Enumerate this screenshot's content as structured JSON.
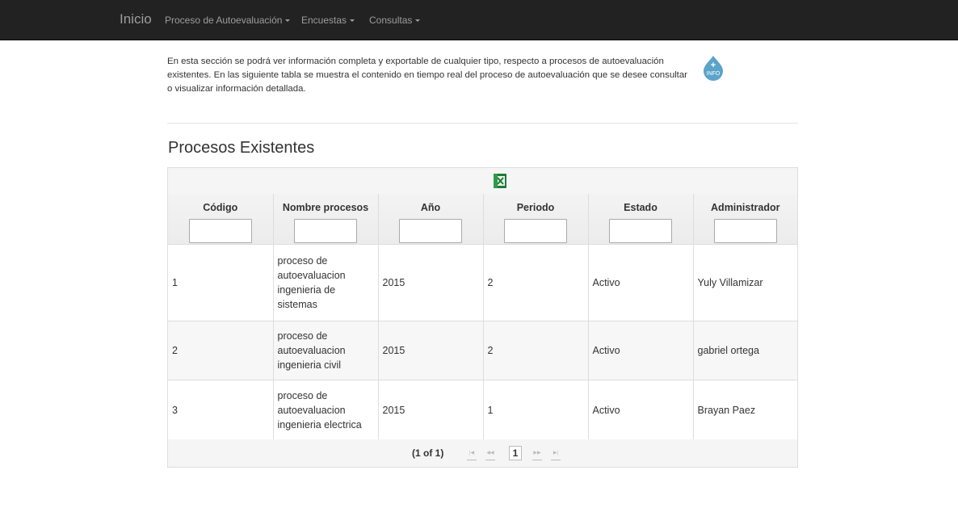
{
  "navbar": {
    "brand": "Inicio",
    "items": [
      {
        "label": "Proceso de Autoevaluación"
      },
      {
        "label": "Encuestas"
      },
      {
        "label": "Consultas"
      }
    ]
  },
  "intro": {
    "text": "En esta sección se podrá ver información completa y exportable de cualquier tipo, respecto a procesos de autoevaluación existentes. En las siguiente tabla se muestra el contenido en tiempo real del proceso de autoevaluación que se desee consultar o visualizar información detallada.",
    "info_icon_label": "+ INFO"
  },
  "section_title": "Procesos Existentes",
  "table": {
    "export_icon": "excel-export-icon",
    "columns": [
      "Código",
      "Nombre procesos",
      "Año",
      "Periodo",
      "Estado",
      "Administrador"
    ],
    "rows": [
      [
        "1",
        "proceso de autoevaluacion ingenieria de sistemas",
        "2015",
        "2",
        "Activo",
        "Yuly Villamizar"
      ],
      [
        "2",
        "proceso de autoevaluacion ingenieria civil",
        "2015",
        "2",
        "Activo",
        "gabriel ortega"
      ],
      [
        "3",
        "proceso de autoevaluacion ingenieria electrica",
        "2015",
        "1",
        "Activo",
        "Brayan Paez"
      ]
    ]
  },
  "paginator": {
    "report": "(1 of 1)",
    "current_page": "1"
  },
  "colors": {
    "navbar_bg": "#222222",
    "nav_text": "#9d9d9d",
    "excel_green": "#1d7a37",
    "info_icon_bg": "#5ba3c9"
  }
}
